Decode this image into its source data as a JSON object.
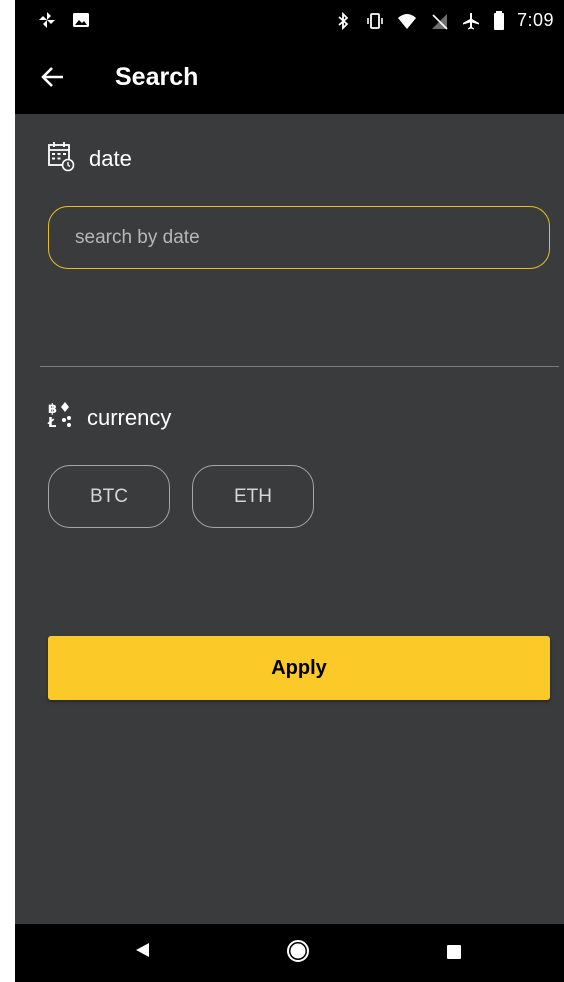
{
  "status_bar": {
    "time": "7:09",
    "left_icons": [
      "pinwheel-icon",
      "image-icon"
    ],
    "right_icons": [
      "bluetooth-icon",
      "vibrate-icon",
      "wifi-icon",
      "no-sim-icon",
      "airplane-icon",
      "battery-icon"
    ]
  },
  "app_bar": {
    "back_icon": "arrow-left-icon",
    "title": "Search"
  },
  "date_section": {
    "icon": "calendar-clock-icon",
    "label": "date",
    "input_placeholder": "search by date",
    "input_value": ""
  },
  "currency_section": {
    "icon": "crypto-currency-icon",
    "label": "currency",
    "options": [
      "BTC",
      "ETH"
    ]
  },
  "apply_button": {
    "label": "Apply"
  },
  "colors": {
    "background": "#3a3b3d",
    "bars": "#000000",
    "accent": "#fbca28",
    "input_border": "#e9bf1f",
    "chip_border": "#a6a6a6"
  },
  "nav_bar": {
    "icons": [
      "nav-back-icon",
      "nav-home-icon",
      "nav-recents-icon"
    ]
  }
}
